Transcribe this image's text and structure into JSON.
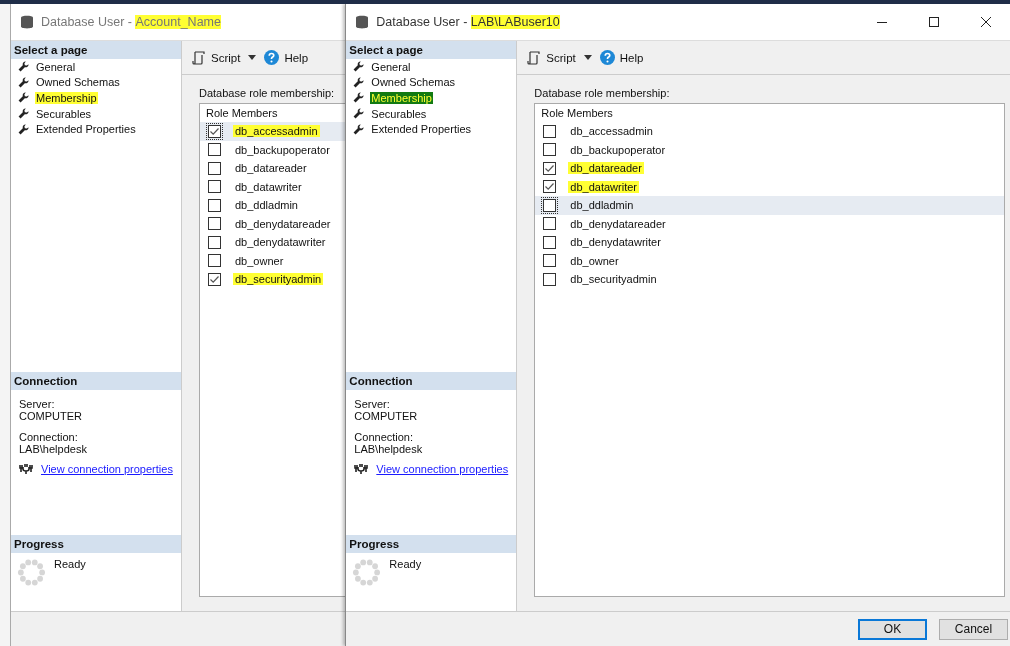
{
  "windows": [
    {
      "title_prefix": "Database User - ",
      "title_name": "Account_Name",
      "name_highlighted": true,
      "sidebar": {
        "header": "Select a page",
        "pages": [
          {
            "label": "General",
            "selected": false,
            "highlighted": false
          },
          {
            "label": "Owned Schemas",
            "selected": false,
            "highlighted": false
          },
          {
            "label": "Membership",
            "selected": false,
            "highlighted": true
          },
          {
            "label": "Securables",
            "selected": false,
            "highlighted": false
          },
          {
            "label": "Extended Properties",
            "selected": false,
            "highlighted": false
          }
        ],
        "connection": {
          "header": "Connection",
          "server_label": "Server:",
          "server": "COMPUTER",
          "connection_label": "Connection:",
          "connection": "LAB\\helpdesk",
          "link": "View connection properties"
        },
        "progress": {
          "header": "Progress",
          "status": "Ready"
        }
      },
      "toolbar": {
        "script": "Script",
        "help": "Help"
      },
      "roles_label": "Database role membership:",
      "column": "Role Members",
      "roles": [
        {
          "name": "db_accessadmin",
          "checked": true,
          "highlighted": true,
          "selected": true
        },
        {
          "name": "db_backupoperator",
          "checked": false,
          "highlighted": false,
          "selected": false
        },
        {
          "name": "db_datareader",
          "checked": false,
          "highlighted": false,
          "selected": false
        },
        {
          "name": "db_datawriter",
          "checked": false,
          "highlighted": false,
          "selected": false
        },
        {
          "name": "db_ddladmin",
          "checked": false,
          "highlighted": false,
          "selected": false
        },
        {
          "name": "db_denydatareader",
          "checked": false,
          "highlighted": false,
          "selected": false
        },
        {
          "name": "db_denydatawriter",
          "checked": false,
          "highlighted": false,
          "selected": false
        },
        {
          "name": "db_owner",
          "checked": false,
          "highlighted": false,
          "selected": false
        },
        {
          "name": "db_securityadmin",
          "checked": true,
          "highlighted": true,
          "selected": false
        }
      ]
    },
    {
      "title_prefix": "Database User - ",
      "title_name": "LAB\\LABuser10",
      "name_highlighted": true,
      "controls": [
        {
          "kind": "minimize"
        },
        {
          "kind": "maximize"
        },
        {
          "kind": "close"
        }
      ],
      "sidebar": {
        "header": "Select a page",
        "pages": [
          {
            "label": "General",
            "selected": false,
            "highlighted": false
          },
          {
            "label": "Owned Schemas",
            "selected": false,
            "highlighted": false
          },
          {
            "label": "Membership",
            "selected": true,
            "highlighted": true
          },
          {
            "label": "Securables",
            "selected": false,
            "highlighted": false
          },
          {
            "label": "Extended Properties",
            "selected": false,
            "highlighted": false
          }
        ],
        "connection": {
          "header": "Connection",
          "server_label": "Server:",
          "server": "COMPUTER",
          "connection_label": "Connection:",
          "connection": "LAB\\helpdesk",
          "link": "View connection properties"
        },
        "progress": {
          "header": "Progress",
          "status": "Ready"
        }
      },
      "toolbar": {
        "script": "Script",
        "help": "Help"
      },
      "roles_label": "Database role membership:",
      "column": "Role Members",
      "roles": [
        {
          "name": "db_accessadmin",
          "checked": false,
          "highlighted": false,
          "selected": false
        },
        {
          "name": "db_backupoperator",
          "checked": false,
          "highlighted": false,
          "selected": false
        },
        {
          "name": "db_datareader",
          "checked": true,
          "highlighted": true,
          "selected": false
        },
        {
          "name": "db_datawriter",
          "checked": true,
          "highlighted": true,
          "selected": false
        },
        {
          "name": "db_ddladmin",
          "checked": false,
          "highlighted": false,
          "selected": true
        },
        {
          "name": "db_denydatareader",
          "checked": false,
          "highlighted": false,
          "selected": false
        },
        {
          "name": "db_denydatawriter",
          "checked": false,
          "highlighted": false,
          "selected": false
        },
        {
          "name": "db_owner",
          "checked": false,
          "highlighted": false,
          "selected": false
        },
        {
          "name": "db_securityadmin",
          "checked": false,
          "highlighted": false,
          "selected": false
        }
      ],
      "buttons": [
        {
          "label": "OK",
          "default": true
        },
        {
          "label": "Cancel",
          "default": false
        }
      ]
    }
  ]
}
